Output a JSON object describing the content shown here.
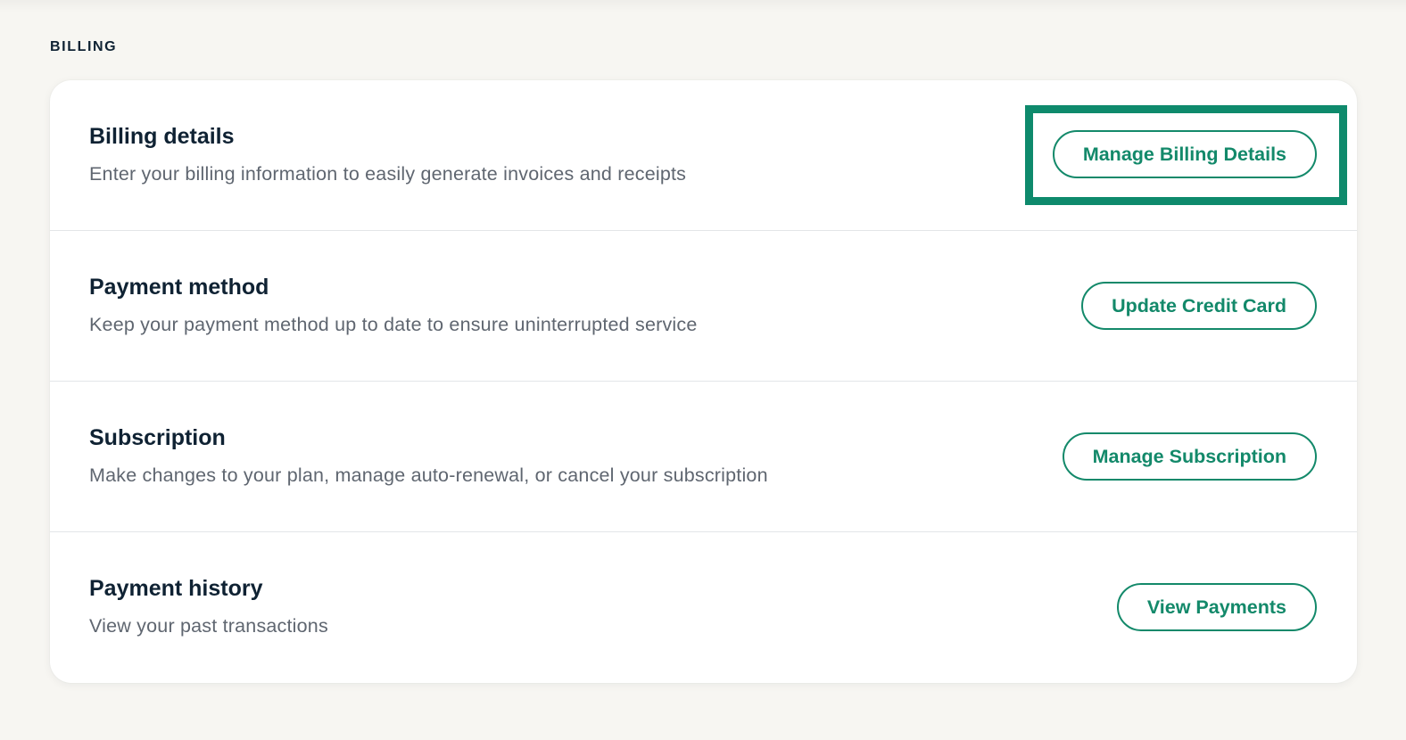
{
  "section": {
    "label": "BILLING"
  },
  "rows": [
    {
      "title": "Billing details",
      "description": "Enter your billing information to easily generate invoices and receipts",
      "button_label": "Manage Billing Details"
    },
    {
      "title": "Payment method",
      "description": "Keep your payment method up to date to ensure uninterrupted service",
      "button_label": "Update Credit Card"
    },
    {
      "title": "Subscription",
      "description": "Make changes to your plan, manage auto-renewal, or cancel your subscription",
      "button_label": "Manage Subscription"
    },
    {
      "title": "Payment history",
      "description": "View your past transactions",
      "button_label": "View Payments"
    }
  ],
  "colors": {
    "accent": "#13896a",
    "highlight": "#0e8a6c",
    "title_text": "#0f2233",
    "description_text": "#5f6670",
    "page_background": "#f7f6f2"
  }
}
